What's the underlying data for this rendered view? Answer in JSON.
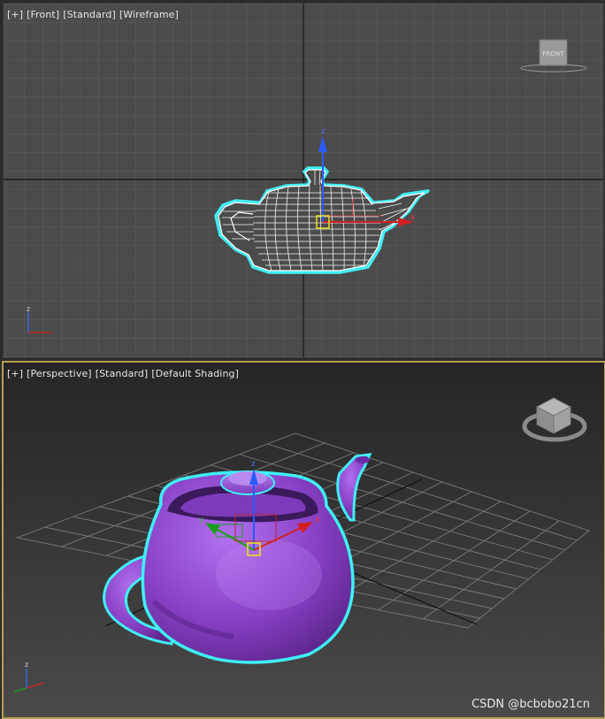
{
  "front_view": {
    "menu_plus": "[+]",
    "view": "[Front]",
    "mode": "[Standard]",
    "shading": "[Wireframe]",
    "viewcube_face": "FRONT",
    "gizmo_z": "z",
    "gizmo_x": "x",
    "axis_z": "z"
  },
  "perspective_view": {
    "menu_plus": "[+]",
    "view": "[Perspective]",
    "mode": "[Standard]",
    "shading": "[Default Shading]",
    "gizmo_z": "z",
    "gizmo_y": "y",
    "gizmo_x": "x",
    "axis_z": "z"
  },
  "colors": {
    "selection_outline": "#3ff0f5",
    "teapot_fill": "#8a42c8",
    "active_border": "#b5a050",
    "gizmo_center": "#e8e020"
  },
  "watermark": "CSDN @bcbobo21cn"
}
